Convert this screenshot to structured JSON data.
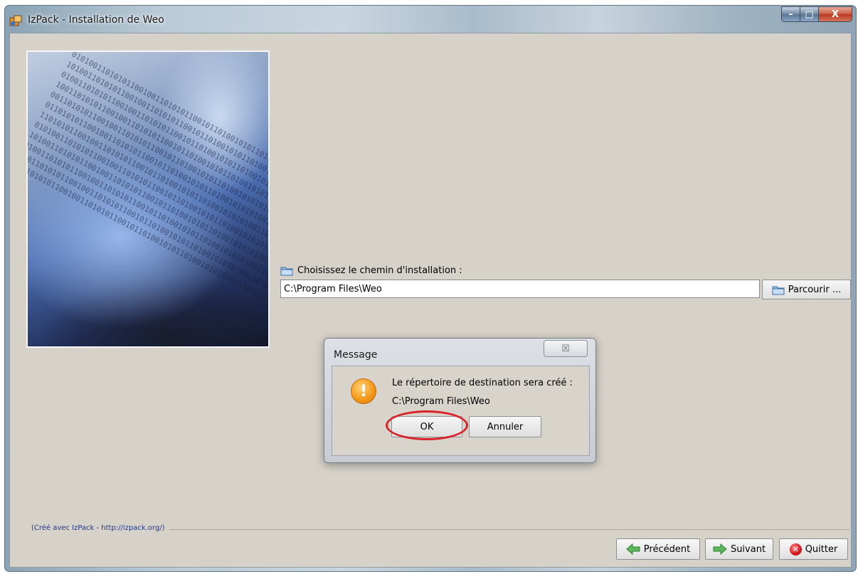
{
  "window": {
    "title": "IzPack - Installation de Weo",
    "buttons": {
      "minimize": "–",
      "maximize": "□",
      "close": "X"
    }
  },
  "install_path": {
    "label": "Choisissez le chemin d'installation :",
    "value": "C:\\Program Files\\Weo",
    "browse_label": "Parcourir ..."
  },
  "dialog": {
    "title": "Message",
    "close_glyph": "☒",
    "icon_glyph": "!",
    "message_line1": "Le répertoire de destination sera créé :",
    "message_line2": "C:\\Program Files\\Weo",
    "ok_label": "OK",
    "cancel_label": "Annuler",
    "highlight_color": "#d8232a"
  },
  "footer": {
    "credit": "(Créé avec IzPack - http://izpack.org/)",
    "previous_label": "Précédent",
    "next_label": "Suivant",
    "quit_label": "Quitter",
    "quit_glyph": "✕"
  },
  "side_image": {
    "icon": "binary-data-ribbon-image",
    "binary_text": "0101001101010110010011010101100101101001010110100101"
  }
}
